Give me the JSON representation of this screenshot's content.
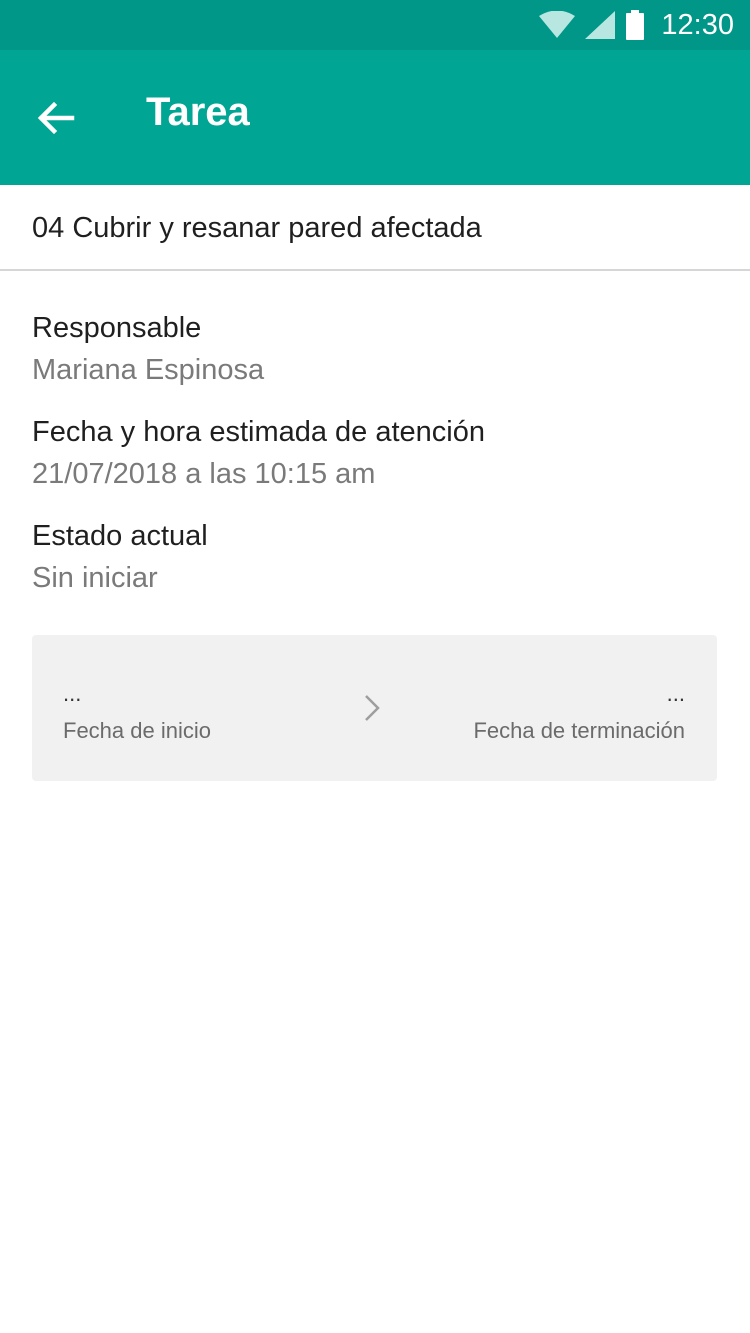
{
  "status_bar": {
    "time": "12:30",
    "icons": [
      "wifi-icon",
      "signal-icon",
      "battery-icon"
    ],
    "background": "#009688"
  },
  "app_bar": {
    "title": "Tarea",
    "back_icon": "arrow-left-icon",
    "background": "#00a693"
  },
  "task": {
    "name": "04 Cubrir y resanar pared afectada"
  },
  "fields": [
    {
      "label": "Responsable",
      "value": "Mariana Espinosa"
    },
    {
      "label": "Fecha y hora estimada de atención",
      "value": "21/07/2018 a las 10:15 am"
    },
    {
      "label": "Estado actual",
      "value": "Sin iniciar"
    }
  ],
  "dates": {
    "start_value": "...",
    "start_label": "Fecha de inicio",
    "end_value": "...",
    "end_label": "Fecha de terminación",
    "separator_icon": "chevron-right-icon"
  }
}
